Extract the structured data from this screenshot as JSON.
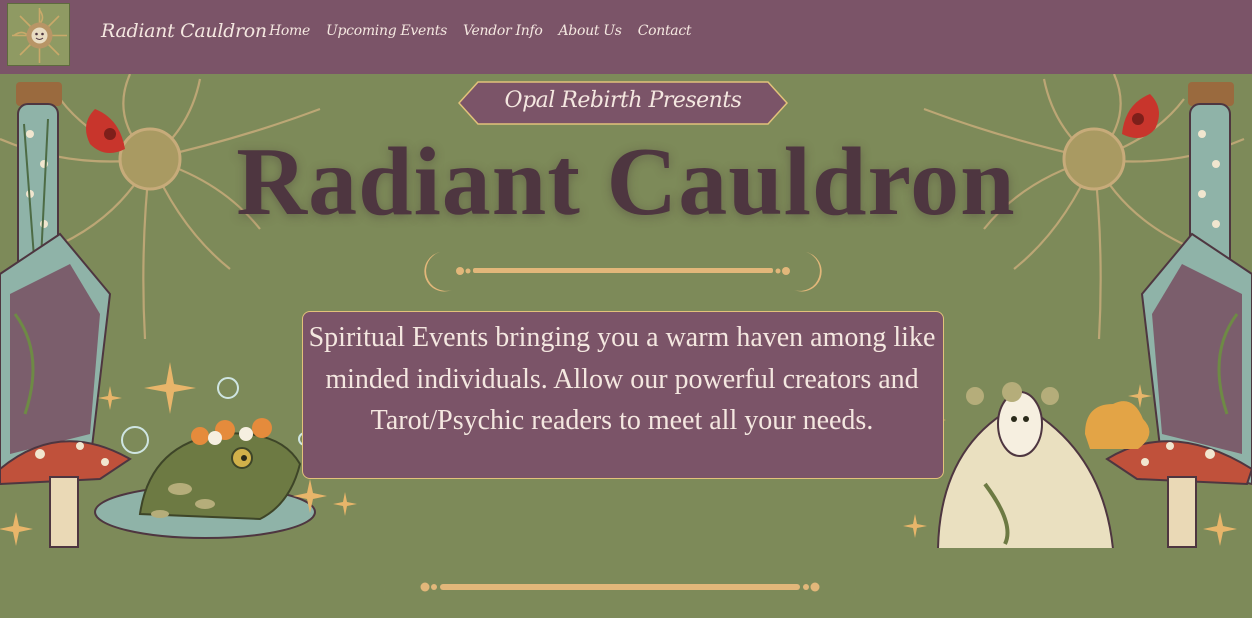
{
  "nav": {
    "brand": "Radiant Cauldron",
    "links": [
      "Home",
      "Upcoming Events",
      "Vendor Info",
      "About Us",
      "Contact"
    ]
  },
  "hero": {
    "presents": "Opal Rebirth Presents",
    "title": "Radiant Cauldron",
    "description": "Spiritual Events bringing you a warm haven among like minded individuals. Allow our powerful creators and Tarot/Psychic readers to meet all your needs."
  },
  "colors": {
    "background": "#7d8a59",
    "nav_bg": "#7b5468",
    "title": "#4e3640",
    "gold": "#e2b77a",
    "text_light": "#f4e7e0"
  },
  "icons": [
    "sun-logo-icon",
    "crescent-moon-icon",
    "sparkle-icon",
    "mushroom-icon",
    "frog-icon",
    "moth-icon",
    "potion-bottle-icon",
    "flower-icon"
  ]
}
